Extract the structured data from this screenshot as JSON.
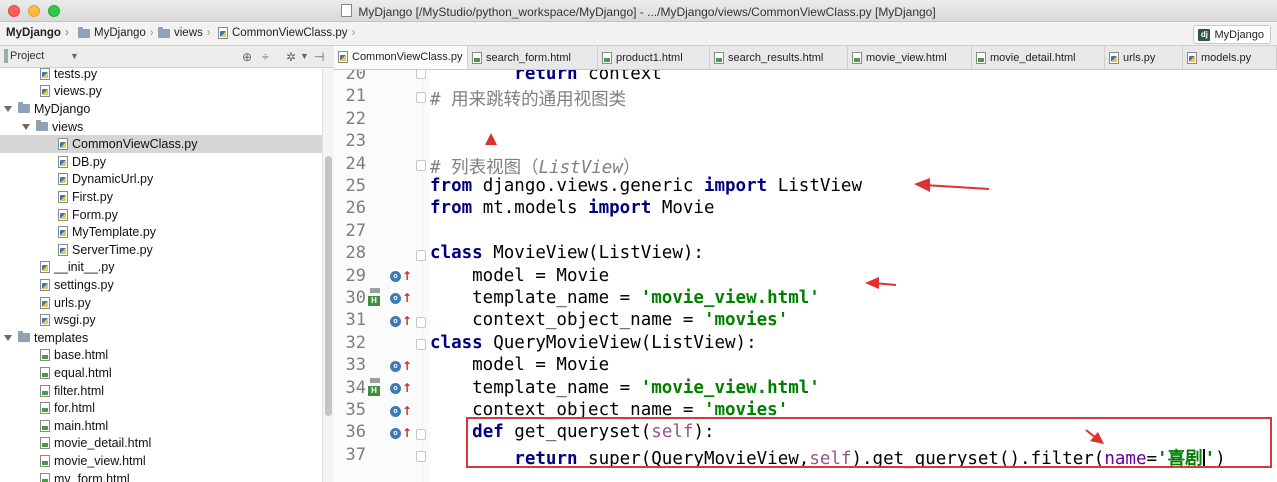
{
  "window": {
    "title": "MyDjango [/MyStudio/python_workspace/MyDjango] - .../MyDjango/views/CommonViewClass.py [MyDjango]"
  },
  "breadcrumb": [
    "MyDjango",
    "MyDjango",
    "views",
    "CommonViewClass.py"
  ],
  "project_badge": "MyDjango",
  "project_panel": {
    "title": "Project"
  },
  "tree": [
    {
      "label": "tests.py",
      "type": "py"
    },
    {
      "label": "views.py",
      "type": "py"
    },
    {
      "label": "MyDjango",
      "type": "folder",
      "expanded": true
    },
    {
      "label": "views",
      "type": "folder",
      "expanded": true
    },
    {
      "label": "CommonViewClass.py",
      "type": "py",
      "selected": true
    },
    {
      "label": "DB.py",
      "type": "py"
    },
    {
      "label": "DynamicUrl.py",
      "type": "py"
    },
    {
      "label": "First.py",
      "type": "py"
    },
    {
      "label": "Form.py",
      "type": "py"
    },
    {
      "label": "MyTemplate.py",
      "type": "py"
    },
    {
      "label": "ServerTime.py",
      "type": "py"
    },
    {
      "label": "__init__.py",
      "type": "py"
    },
    {
      "label": "settings.py",
      "type": "py"
    },
    {
      "label": "urls.py",
      "type": "py"
    },
    {
      "label": "wsgi.py",
      "type": "py"
    },
    {
      "label": "templates",
      "type": "folder",
      "expanded": true
    },
    {
      "label": "base.html",
      "type": "html"
    },
    {
      "label": "equal.html",
      "type": "html"
    },
    {
      "label": "filter.html",
      "type": "html"
    },
    {
      "label": "for.html",
      "type": "html"
    },
    {
      "label": "main.html",
      "type": "html"
    },
    {
      "label": "movie_detail.html",
      "type": "html"
    },
    {
      "label": "movie_view.html",
      "type": "html"
    },
    {
      "label": "my_form.html",
      "type": "html"
    }
  ],
  "tabs": [
    {
      "label": "CommonViewClass.py",
      "type": "py",
      "active": true
    },
    {
      "label": "search_form.html",
      "type": "html"
    },
    {
      "label": "product1.html",
      "type": "html"
    },
    {
      "label": "search_results.html",
      "type": "html"
    },
    {
      "label": "movie_view.html",
      "type": "html"
    },
    {
      "label": "movie_detail.html",
      "type": "html"
    },
    {
      "label": "urls.py",
      "type": "py"
    },
    {
      "label": "models.py",
      "type": "py"
    }
  ],
  "code": {
    "l20": {
      "num": "20",
      "ret": "return",
      "rest": " context"
    },
    "l21": {
      "num": "21",
      "text": "# 用来跳转的通用视图类"
    },
    "l22": {
      "num": "22"
    },
    "l23": {
      "num": "23"
    },
    "l24": {
      "num": "24",
      "a": "# 列表视图（",
      "b": "ListView",
      "c": "）"
    },
    "l25": {
      "num": "25",
      "k1": "from",
      "m": " django.views.generic ",
      "k2": "import",
      "n": " ListView"
    },
    "l26": {
      "num": "26",
      "k1": "from",
      "m": " mt.models ",
      "k2": "import",
      "n": " Movie"
    },
    "l27": {
      "num": "27"
    },
    "l28": {
      "num": "28",
      "k": "class",
      "rest": " MovieView(ListView):"
    },
    "l29": {
      "num": "29",
      "text": "    model = Movie"
    },
    "l30": {
      "num": "30",
      "pre": "    template_name = ",
      "s": "'movie_view.html'"
    },
    "l31": {
      "num": "31",
      "pre": "    context_object_name = ",
      "s": "'movies'"
    },
    "l32": {
      "num": "32",
      "k": "class",
      "rest": " QueryMovieView(ListView):"
    },
    "l33": {
      "num": "33",
      "text": "    model = Movie"
    },
    "l34": {
      "num": "34",
      "pre": "    template_name = ",
      "s": "'movie_view.html'"
    },
    "l35": {
      "num": "35",
      "pre": "    context_object_name = ",
      "s": "'movies'"
    },
    "l36": {
      "num": "36",
      "ind": "    ",
      "k": "def",
      "rest": " get_queryset(",
      "self": "self",
      "end": "):"
    },
    "l37": {
      "num": "37",
      "ind": "        ",
      "k": "return",
      "a": " super(QueryMovieView,",
      "self": "self",
      "b": ").get_queryset().filter(",
      "kw": "name",
      "eq": "=",
      "s1": "'喜剧",
      "s2": "'",
      "end": ")"
    }
  },
  "colors": {
    "annotation_arrows": "#e03030",
    "highlight_box": "#d8383b",
    "keyword": "#000080",
    "string": "#008000",
    "comment": "#808080",
    "self": "#94558d"
  }
}
